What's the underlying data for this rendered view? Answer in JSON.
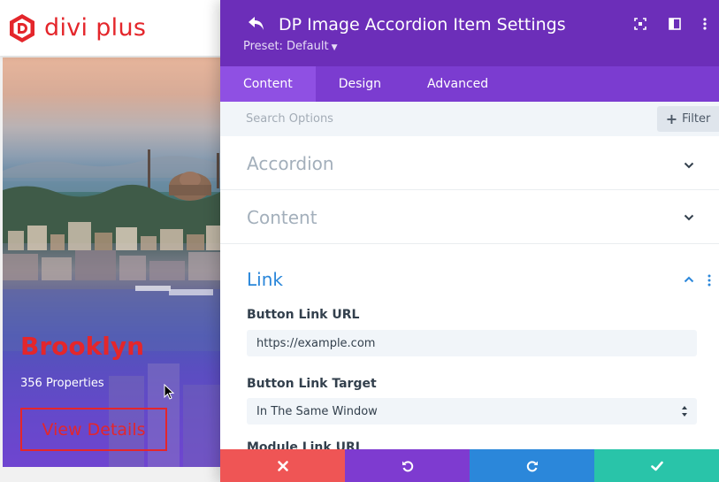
{
  "site": {
    "logo_text": "divi plus",
    "brand_color": "#e4262b"
  },
  "preview": {
    "title": "Brooklyn",
    "subtitle": "356 Properties",
    "button_label": "View Details",
    "overlay_color": "#6c45d0"
  },
  "modal": {
    "title": "DP Image Accordion Item Settings",
    "preset_label": "Preset: Default",
    "header_color": "#6c2eb9",
    "icons": [
      "back-icon",
      "focus-icon",
      "split-view-icon",
      "more-vertical-icon"
    ]
  },
  "tabs": [
    {
      "label": "Content",
      "active": true
    },
    {
      "label": "Design",
      "active": false
    },
    {
      "label": "Advanced",
      "active": false
    }
  ],
  "search": {
    "placeholder": "Search Options",
    "filter_label": "Filter"
  },
  "sections": [
    {
      "title": "Accordion",
      "open": false
    },
    {
      "title": "Content",
      "open": false
    },
    {
      "title": "Link",
      "open": true
    }
  ],
  "link_section": {
    "button_link_url_label": "Button Link URL",
    "button_link_url_value": "https://example.com",
    "button_link_target_label": "Button Link Target",
    "button_link_target_value": "In The Same Window",
    "next_label_partial": "Module Link URL"
  },
  "footer": {
    "buttons": [
      {
        "action": "discard",
        "icon": "close-icon",
        "color": "#ef5555"
      },
      {
        "action": "undo",
        "icon": "undo-icon",
        "color": "#7e3bd0"
      },
      {
        "action": "redo",
        "icon": "redo-icon",
        "color": "#2b87da"
      },
      {
        "action": "save",
        "icon": "check-icon",
        "color": "#29c4a9"
      }
    ]
  }
}
